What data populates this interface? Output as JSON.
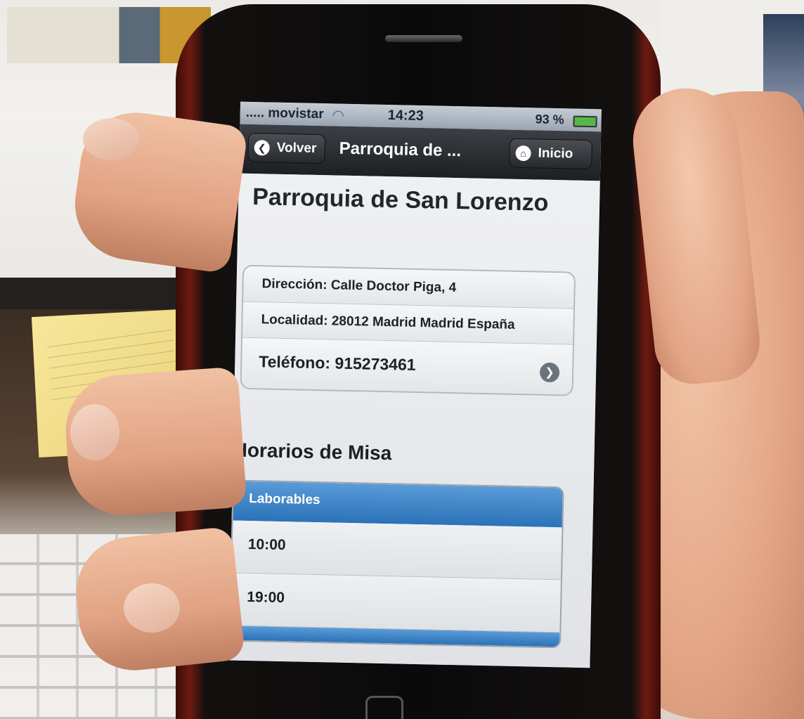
{
  "status_bar": {
    "carrier": "..... movistar",
    "time": "14:23",
    "battery": "93 %"
  },
  "nav_bar": {
    "back_label": "Volver",
    "title": "Parroquia de ...",
    "home_label": "Inicio"
  },
  "page": {
    "title": "Parroquia de San Lorenzo",
    "info_rows": [
      {
        "label": "Dirección: Calle Doctor Piga, 4"
      },
      {
        "label": "Localidad: 28012 Madrid Madrid España"
      },
      {
        "label": "Teléfono: 915273461"
      }
    ],
    "section_title": "Horarios de Misa",
    "mass_schedule": {
      "header": "Laborables",
      "times": [
        "10:00",
        "19:00"
      ]
    }
  },
  "icons": {
    "back": "chevron-left-icon",
    "home": "home-icon",
    "wifi": "wifi-icon",
    "battery": "battery-icon",
    "disclosure": "chevron-right-icon"
  },
  "colors": {
    "nav_bar": "#1d1f22",
    "list_header_blue": "#2b72b8"
  }
}
